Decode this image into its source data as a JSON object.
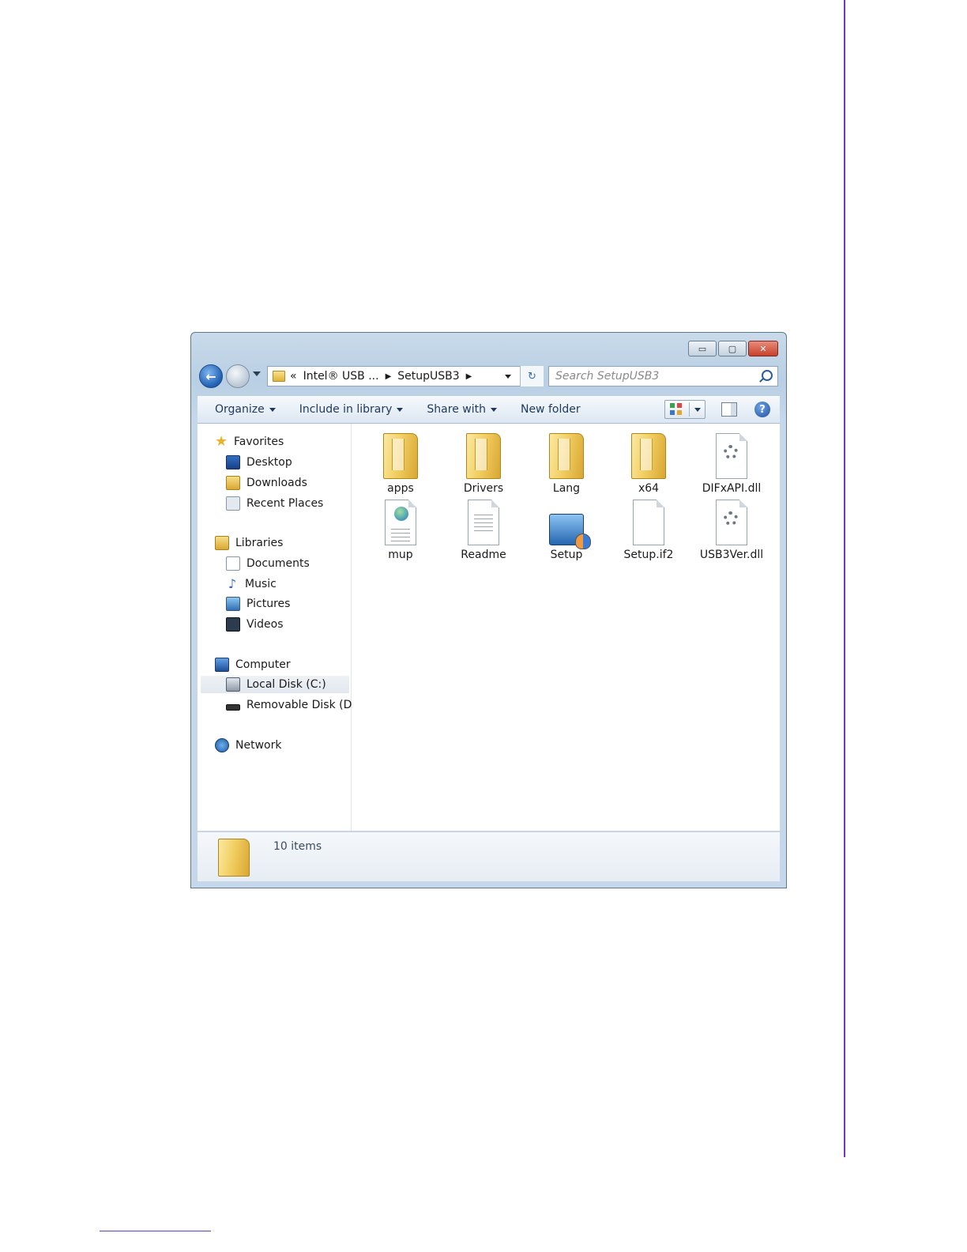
{
  "window": {
    "controls": {
      "minimize": "▭",
      "maximize": "▢",
      "close": "✕"
    }
  },
  "nav": {
    "address": {
      "prefix": "«",
      "crumbs": [
        "Intel® USB ...",
        "SetupUSB3"
      ]
    },
    "search_placeholder": "Search SetupUSB3",
    "refresh_glyph": "↻"
  },
  "toolbar": {
    "organize": "Organize",
    "include": "Include in library",
    "share": "Share with",
    "new_folder": "New folder",
    "help": "?"
  },
  "sidebar": {
    "favorites": {
      "label": "Favorites",
      "items": [
        "Desktop",
        "Downloads",
        "Recent Places"
      ]
    },
    "libraries": {
      "label": "Libraries",
      "items": [
        "Documents",
        "Music",
        "Pictures",
        "Videos"
      ]
    },
    "computer": {
      "label": "Computer",
      "items": [
        "Local Disk (C:)",
        "Removable Disk (D:)"
      ]
    },
    "network": {
      "label": "Network"
    }
  },
  "files": [
    {
      "name": "apps",
      "icon": "folder-icon"
    },
    {
      "name": "Drivers",
      "icon": "folder-icon"
    },
    {
      "name": "Lang",
      "icon": "folder-icon"
    },
    {
      "name": "x64",
      "icon": "folder-icon"
    },
    {
      "name": "DIFxAPI.dll",
      "icon": "dll-icon"
    },
    {
      "name": "mup",
      "icon": "xml-icon"
    },
    {
      "name": "Readme",
      "icon": "text-file-icon"
    },
    {
      "name": "Setup",
      "icon": "setup-icon"
    },
    {
      "name": "Setup.if2",
      "icon": "blank-file-icon"
    },
    {
      "name": "USB3Ver.dll",
      "icon": "dll-icon"
    }
  ],
  "status": {
    "item_count": "10 items"
  },
  "colors": {
    "page_rule": "#7b2fd4",
    "window_frame": "#c9daea",
    "close_button": "#c8412b"
  }
}
